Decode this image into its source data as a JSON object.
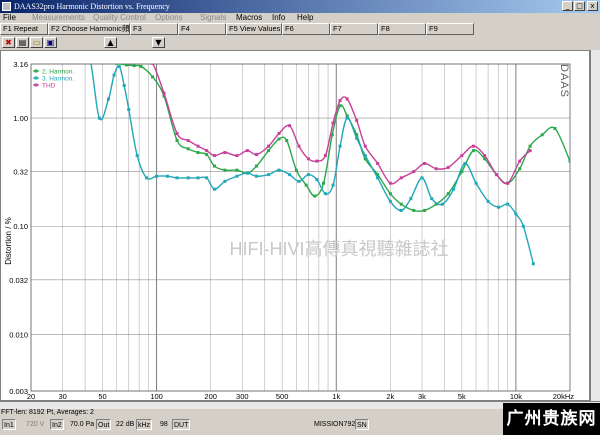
{
  "window": {
    "title": "DAAS32pro  Harmonic Distortion vs. Frequency"
  },
  "window_controls": {
    "minimize": "_",
    "maximize": "□",
    "close": "x"
  },
  "menu": [
    {
      "label": "File",
      "enabled": true
    },
    {
      "label": "Measurements",
      "enabled": false
    },
    {
      "label": "Quality Control",
      "enabled": false
    },
    {
      "label": "Options",
      "enabled": false
    },
    {
      "label": "Signals",
      "enabled": false
    },
    {
      "label": "Macros",
      "enabled": true
    },
    {
      "label": "Info",
      "enabled": true
    },
    {
      "label": "Help",
      "enabled": true
    }
  ],
  "function_keys": [
    {
      "label": "F1 Repeat"
    },
    {
      "label": "F2 Choose Harmonic頻"
    },
    {
      "label": "F3"
    },
    {
      "label": "F4"
    },
    {
      "label": "F5 View Values"
    },
    {
      "label": "F6"
    },
    {
      "label": "F7"
    },
    {
      "label": "F8"
    },
    {
      "label": "F9"
    }
  ],
  "toolbar": {
    "buttons": [
      {
        "icon": "cancel-icon",
        "glyph": "✖"
      },
      {
        "icon": "print-icon",
        "glyph": "▤"
      },
      {
        "icon": "open-folder-icon",
        "glyph": "▭"
      },
      {
        "icon": "save-icon",
        "glyph": "▣"
      },
      {
        "icon": "scroll-up-icon",
        "glyph": "▲"
      },
      {
        "icon": "scroll-down-icon",
        "glyph": "▼"
      }
    ]
  },
  "chart_data": {
    "type": "line",
    "title": "",
    "xlabel": "",
    "ylabel": "Distortion / %",
    "x_scale": "log",
    "y_scale": "log",
    "xlim": [
      20,
      20000
    ],
    "ylim": [
      0.003,
      3.16
    ],
    "x_tick_labels": [
      "20",
      "30",
      "50",
      "100",
      "200",
      "300",
      "500",
      "1k",
      "2k",
      "3k",
      "5k",
      "10k",
      "20kHz"
    ],
    "y_tick_labels": [
      "3.16",
      "1.00",
      "0.32",
      "0.10",
      "0.032",
      "0.010",
      "0.003"
    ],
    "grid": true,
    "legend": "top-left",
    "brand_label": "DAAS",
    "watermark": "HIFI-HIVI高傳真視聽雜誌社",
    "series": [
      {
        "name": "2. Harmon.",
        "color": "#2aa84a",
        "x": [
          35,
          40,
          46,
          52,
          60,
          68,
          75,
          82,
          95,
          110,
          130,
          150,
          170,
          190,
          210,
          240,
          280,
          320,
          360,
          420,
          480,
          530,
          600,
          680,
          760,
          850,
          950,
          1050,
          1150,
          1300,
          1450,
          1700,
          2000,
          2300,
          2700,
          3100,
          3600,
          4200,
          5000,
          5800,
          6700,
          7800,
          9000,
          10500,
          12000,
          14000,
          16500,
          20000
        ],
        "y": [
          4.5,
          3.8,
          3.5,
          3.4,
          3.2,
          3.1,
          3.05,
          3.0,
          2.4,
          1.6,
          0.62,
          0.52,
          0.48,
          0.46,
          0.36,
          0.33,
          0.33,
          0.31,
          0.36,
          0.5,
          0.64,
          0.62,
          0.33,
          0.24,
          0.19,
          0.25,
          0.7,
          1.3,
          1.05,
          0.7,
          0.42,
          0.3,
          0.2,
          0.16,
          0.14,
          0.14,
          0.16,
          0.2,
          0.32,
          0.5,
          0.42,
          0.3,
          0.25,
          0.34,
          0.55,
          0.7,
          0.8,
          0.4
        ]
      },
      {
        "name": "3. Harmon.",
        "color": "#1fa8b8",
        "x": [
          35,
          42,
          48,
          54,
          58,
          62,
          66,
          70,
          78,
          88,
          100,
          115,
          130,
          150,
          170,
          190,
          210,
          240,
          280,
          320,
          360,
          420,
          480,
          550,
          620,
          700,
          780,
          870,
          960,
          1050,
          1150,
          1300,
          1450,
          1700,
          2000,
          2300,
          2600,
          3000,
          3400,
          3900,
          4500,
          5200,
          6000,
          7000,
          8000,
          9000,
          10000,
          11000,
          12500
        ],
        "y": [
          4.5,
          3.9,
          1.0,
          1.5,
          2.5,
          3.0,
          2.0,
          1.2,
          0.45,
          0.28,
          0.29,
          0.29,
          0.28,
          0.28,
          0.28,
          0.28,
          0.22,
          0.26,
          0.29,
          0.31,
          0.29,
          0.3,
          0.33,
          0.3,
          0.26,
          0.3,
          0.27,
          0.2,
          0.24,
          0.55,
          1.0,
          0.65,
          0.45,
          0.28,
          0.17,
          0.14,
          0.18,
          0.28,
          0.18,
          0.16,
          0.22,
          0.38,
          0.25,
          0.17,
          0.15,
          0.16,
          0.13,
          0.1,
          0.045
        ]
      },
      {
        "name": "THD",
        "color": "#c8409a",
        "x": [
          35,
          42,
          50,
          58,
          66,
          75,
          85,
          95,
          110,
          130,
          150,
          170,
          190,
          210,
          240,
          280,
          320,
          360,
          420,
          480,
          550,
          620,
          700,
          780,
          870,
          960,
          1050,
          1150,
          1300,
          1450,
          1700,
          2000,
          2300,
          2700,
          3100,
          3600,
          4200,
          5000,
          5800,
          6700,
          7800,
          9000,
          10500,
          12000
        ],
        "y": [
          4.7,
          4.2,
          3.8,
          3.5,
          3.4,
          3.3,
          3.3,
          3.2,
          1.7,
          0.72,
          0.62,
          0.55,
          0.5,
          0.45,
          0.48,
          0.45,
          0.5,
          0.46,
          0.55,
          0.72,
          0.85,
          0.55,
          0.42,
          0.4,
          0.45,
          0.9,
          1.45,
          1.5,
          0.95,
          0.55,
          0.38,
          0.25,
          0.28,
          0.32,
          0.38,
          0.34,
          0.35,
          0.45,
          0.55,
          0.45,
          0.3,
          0.25,
          0.4,
          0.5
        ]
      }
    ]
  },
  "status": {
    "fft_info": "FFT-len: 8192 Pt, Averages: 2",
    "in1": "In1",
    "voltage": "720 V",
    "in2": "In2",
    "pressure": "70.0 Pa",
    "out": "Out",
    "gain": "22 dB",
    "khz": "kHz",
    "n98": "98",
    "dut": "DUT",
    "mission": "MISSION792",
    "sn": "SN"
  },
  "logo": {
    "text": "广州贵族网"
  }
}
